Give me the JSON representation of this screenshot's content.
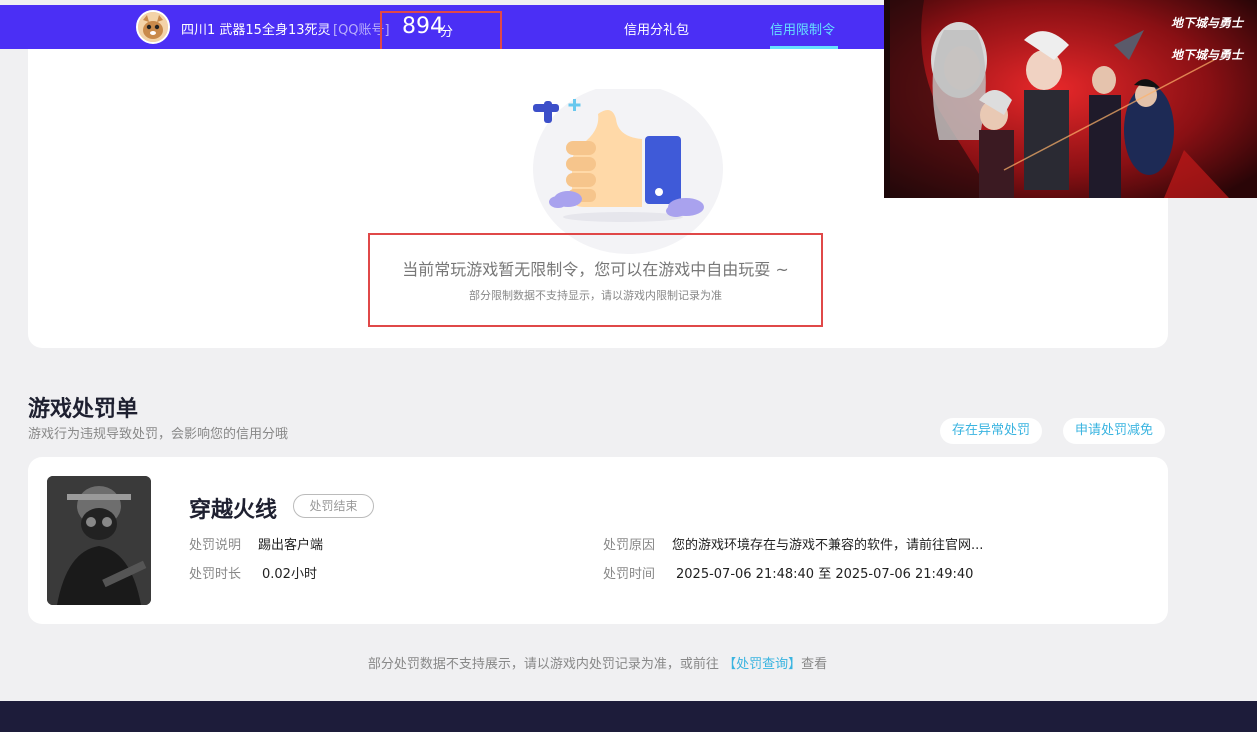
{
  "header": {
    "username": "四川1 武器15全身13死灵",
    "account_type": "[QQ账号]",
    "score": "894",
    "score_unit": "分",
    "nav": [
      "信用分礼包",
      "信用限制令"
    ],
    "active_tab": "信用限制令"
  },
  "limit": {
    "message": "当前常玩游戏暂无限制令，您可以在游戏中自由玩耍 ~",
    "sub_message": "部分限制数据不支持显示，请以游戏内限制记录为准"
  },
  "penalty": {
    "title": "游戏处罚单",
    "subtitle": "游戏行为违规导致处罚，会影响您的信用分哦",
    "actions": [
      "存在异常处罚",
      "申请处罚减免"
    ],
    "records": [
      {
        "game": "穿越火线",
        "status": "处罚结束",
        "desc_label": "处罚说明",
        "desc": "踢出客户端",
        "duration_label": "处罚时长",
        "duration": "0.02小时",
        "reason_label": "处罚原因",
        "reason": "您的游戏环境存在与游戏不兼容的软件，请前往官网...",
        "time_label": "处罚时间",
        "time": "2025-07-06 21:48:40 至 2025-07-06 21:49:40"
      }
    ]
  },
  "footer": {
    "note_before": "部分处罚数据不支持展示，请以游戏内处罚记录为准，或前往",
    "link": "【处罚查询】",
    "note_after": "查看"
  },
  "ad": {
    "logo_text_1": "地下城与勇士",
    "logo_text_2": "地下城与勇士"
  },
  "colors": {
    "header_bg": "#4b2ff5",
    "accent": "#3ab4e0",
    "highlight_box": "#e04848",
    "footer_bg": "#1d1c3a"
  }
}
